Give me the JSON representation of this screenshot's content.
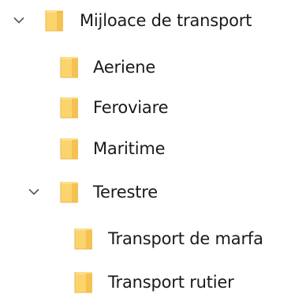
{
  "tree": {
    "items": [
      {
        "label": "Mijloace de transport",
        "icon": "folder-icon",
        "expanded": true,
        "level": 0
      },
      {
        "label": "Aeriene",
        "icon": "folder-icon",
        "level": 1
      },
      {
        "label": "Feroviare",
        "icon": "folder-icon",
        "level": 1
      },
      {
        "label": "Maritime",
        "icon": "folder-icon",
        "level": 1
      },
      {
        "label": "Terestre",
        "icon": "folder-icon",
        "expanded": true,
        "level": 1
      },
      {
        "label": "Transport de marfa",
        "icon": "folder-icon",
        "level": 2
      },
      {
        "label": "Transport rutier",
        "icon": "folder-icon",
        "level": 2
      }
    ]
  },
  "colors": {
    "folder_fill": "#fcd46d",
    "folder_shade": "#f4c152",
    "folder_edge": "#e4a927",
    "chevron": "#5f5f5f",
    "text": "#1a1a1a"
  }
}
